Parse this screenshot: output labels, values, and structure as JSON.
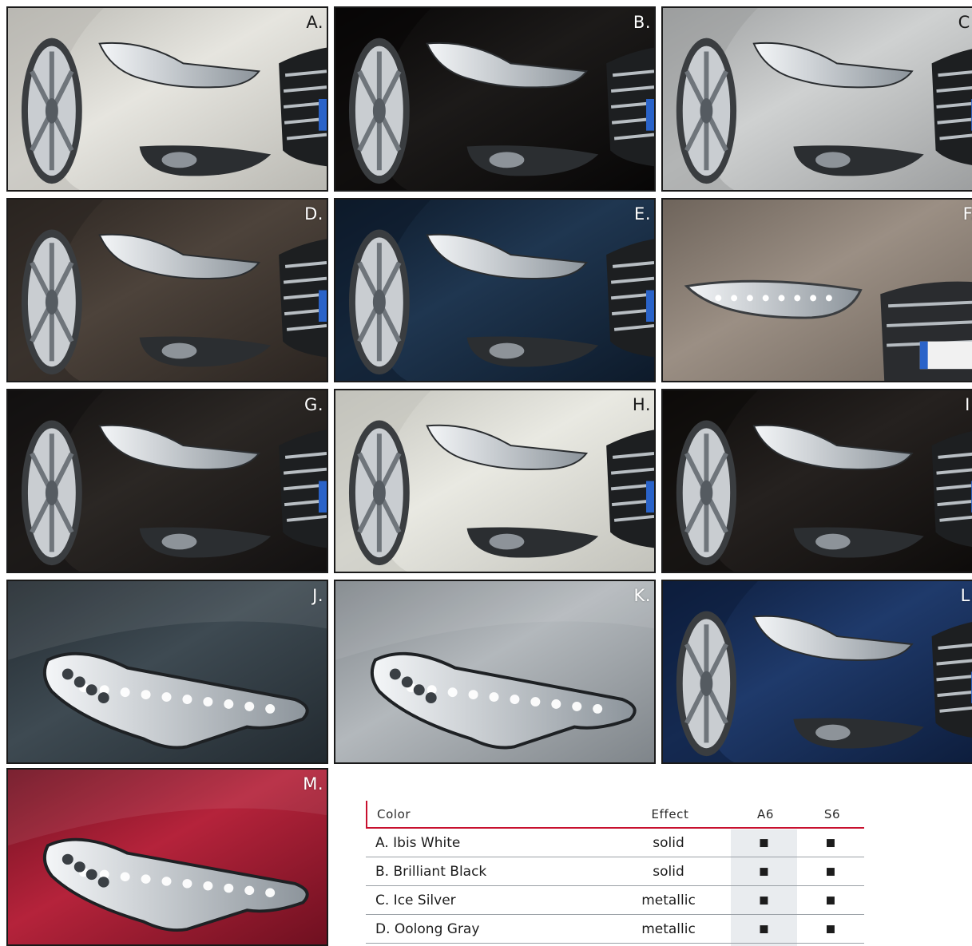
{
  "swatches": [
    {
      "letter": "A.",
      "base": "#e6e5df",
      "shade": "#b9b8b2",
      "light": true,
      "kind": "front"
    },
    {
      "letter": "B.",
      "base": "#1c1a19",
      "shade": "#070606",
      "light": false,
      "kind": "front"
    },
    {
      "letter": "C.",
      "base": "#cfd1d1",
      "shade": "#9c9e9f",
      "light": true,
      "kind": "front"
    },
    {
      "letter": "D.",
      "base": "#4d433b",
      "shade": "#2a2420",
      "light": false,
      "kind": "front"
    },
    {
      "letter": "E.",
      "base": "#1f3650",
      "shade": "#0d1a2a",
      "light": false,
      "kind": "front"
    },
    {
      "letter": "F.",
      "base": "#9b8f84",
      "shade": "#6e645b",
      "light": false,
      "kind": "closeup"
    },
    {
      "letter": "G.",
      "base": "#2b2724",
      "shade": "#121010",
      "light": false,
      "kind": "front"
    },
    {
      "letter": "H.",
      "base": "#e9e9e2",
      "shade": "#c2c2bb",
      "light": true,
      "kind": "front"
    },
    {
      "letter": "I.",
      "base": "#25211f",
      "shade": "#0d0b0a",
      "light": false,
      "kind": "front"
    },
    {
      "letter": "J.",
      "base": "#3e4a52",
      "shade": "#222a30",
      "light": false,
      "kind": "headlight"
    },
    {
      "letter": "K.",
      "base": "#b3b8bc",
      "shade": "#7f858a",
      "light": false,
      "kind": "headlight"
    },
    {
      "letter": "L.",
      "base": "#1f3a6b",
      "shade": "#0d1d3c",
      "light": false,
      "kind": "front"
    },
    {
      "letter": "M.",
      "base": "#b5233b",
      "shade": "#6f1020",
      "light": false,
      "kind": "headlight"
    }
  ],
  "table": {
    "headers": {
      "color": "Color",
      "effect": "Effect",
      "a6": "A6",
      "s6": "S6"
    },
    "rows": [
      {
        "color": "A. Ibis White",
        "effect": "solid",
        "a6": "■",
        "s6": "■"
      },
      {
        "color": "B. Brilliant Black",
        "effect": "solid",
        "a6": "■",
        "s6": "■"
      },
      {
        "color": "C. Ice Silver",
        "effect": "metallic",
        "a6": "■",
        "s6": "■"
      },
      {
        "color": "D. Oolong Gray",
        "effect": "metallic",
        "a6": "■",
        "s6": "■"
      }
    ],
    "accent_color": "#c8102e"
  }
}
